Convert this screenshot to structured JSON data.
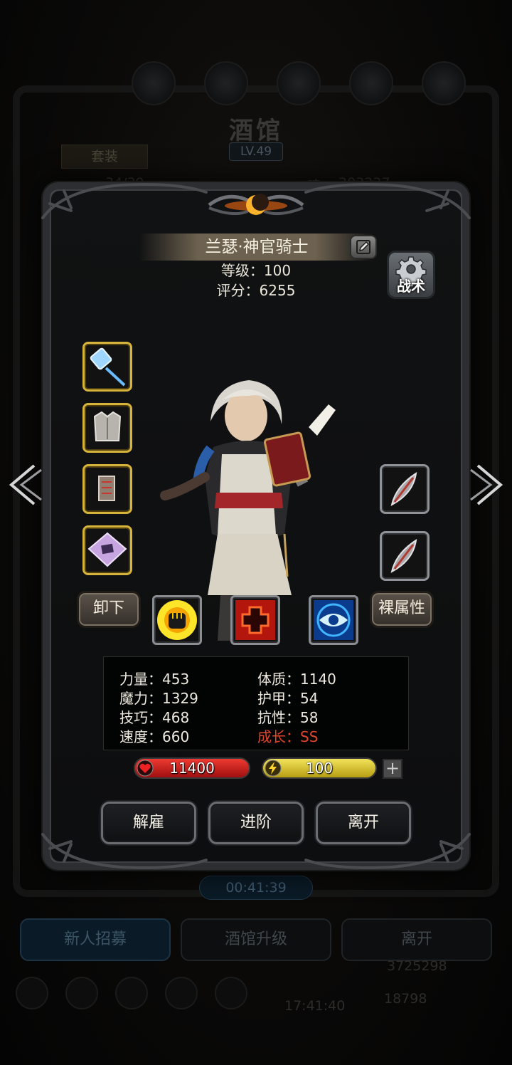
{
  "background": {
    "title": "酒馆",
    "level": "LV.49",
    "suit_tab": "套装",
    "roster_count": "34/39",
    "soul_label": "魂：",
    "soul_value": "203227",
    "timer": "00:41:39",
    "buttons": {
      "recruit": "新人招募",
      "upgrade": "酒馆升级",
      "leave": "离开"
    },
    "currency_1": "3725298",
    "currency_2": "18798",
    "clock": "17:41:40"
  },
  "hero": {
    "name": "兰瑟·神官骑士",
    "level_label": "等级：100",
    "score_label": "评分：6255"
  },
  "tactics_label": "战术",
  "equipment": {
    "left": [
      "hammer-weapon-icon",
      "chest-armor-icon",
      "gloves-icon",
      "rune-tablet-icon"
    ],
    "right": [
      "feather-accessory-icon",
      "feather-accessory-icon"
    ]
  },
  "buttons": {
    "unequip": "卸下",
    "bare_stats": "裸属性",
    "dismiss": "解雇",
    "advance": "进阶",
    "leave": "离开"
  },
  "skills": [
    "fist-skill-icon",
    "heal-cross-skill-icon",
    "eye-skill-icon"
  ],
  "stats": {
    "strength": "力量：453",
    "magic": "魔力：1329",
    "skill": "技巧：468",
    "speed": "速度：660",
    "constitution": "体质：1140",
    "armor": "护甲：54",
    "resistance": "抗性：58",
    "growth": "成长：SS"
  },
  "bars": {
    "hp": "11400",
    "energy": "100"
  },
  "colors": {
    "gold_border": "#d6b43a",
    "hp": "#d51f1f",
    "energy": "#e2cc2c",
    "growth": "#e2452b"
  }
}
